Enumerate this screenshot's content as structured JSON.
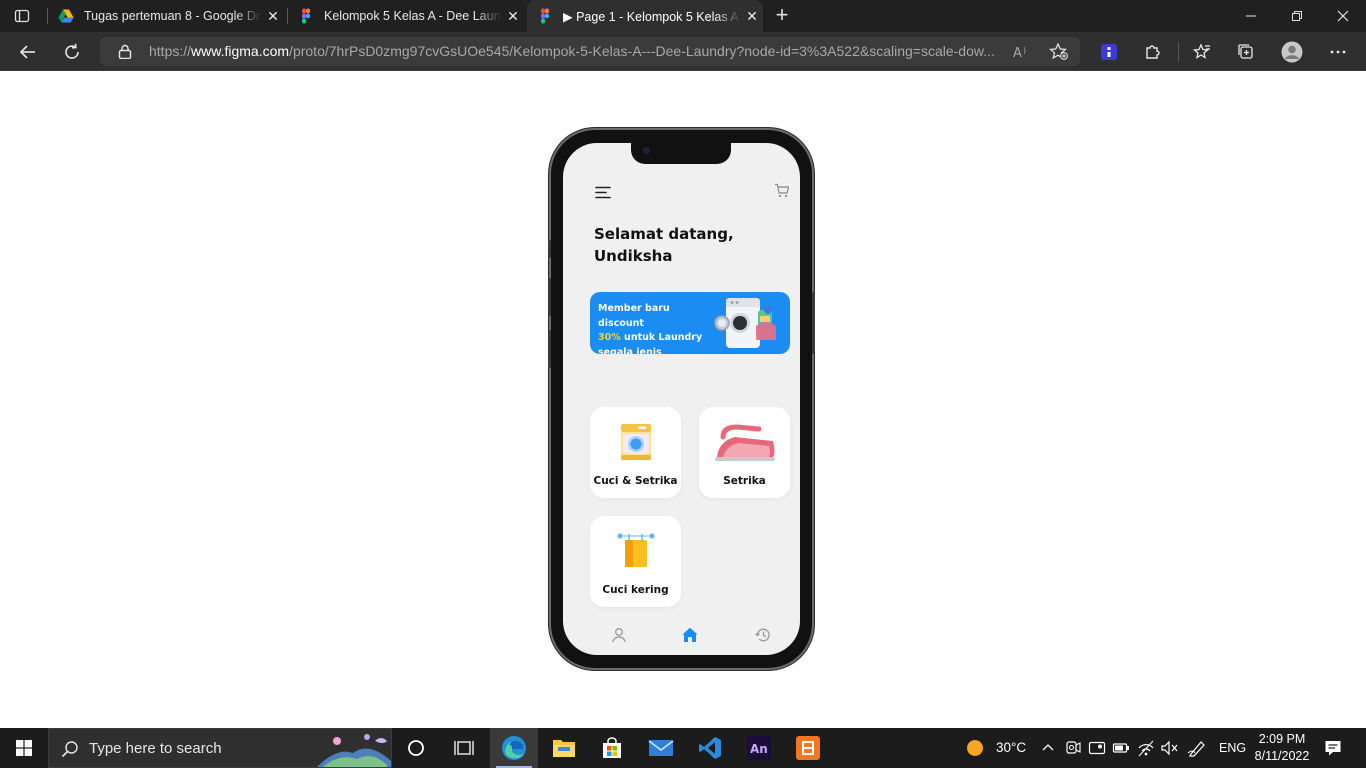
{
  "browser": {
    "tabs": [
      {
        "title": "Tugas pertemuan 8 - Google Dri",
        "icon": "google-drive-icon",
        "active": false
      },
      {
        "title": "Kelompok 5 Kelas A - Dee Laund",
        "icon": "figma-icon",
        "active": false
      },
      {
        "title": "▶ Page 1 - Kelompok 5 Kelas A -",
        "icon": "figma-icon",
        "active": true
      }
    ],
    "url_prefix": "https://",
    "url_host": "www.figma.com",
    "url_rest": "/proto/7hrPsD0zmg97cvGsUOe545/Kelompok-5-Kelas-A---Dee-Laundry?node-id=3%3A522&scaling=scale-dow..."
  },
  "app": {
    "greeting_line1": "Selamat datang,",
    "greeting_line2": "Undiksha",
    "banner": {
      "line1": "Member baru discount",
      "highlight": "30%",
      "line2_rest": " untuk Laundry",
      "line3": "segala jenis"
    },
    "services": [
      {
        "label": "Cuci & Setrika",
        "icon": "washing-machine-icon"
      },
      {
        "label": "Setrika",
        "icon": "iron-icon"
      },
      {
        "label": "Cuci kering",
        "icon": "dryer-icon"
      }
    ],
    "bottom_nav": [
      "profile-icon",
      "home-icon",
      "history-icon"
    ],
    "accent_color": "#1a8cf2"
  },
  "taskbar": {
    "search_placeholder": "Type here to search",
    "weather": "30°C",
    "language": "ENG",
    "time": "2:09 PM",
    "date": "8/11/2022"
  }
}
